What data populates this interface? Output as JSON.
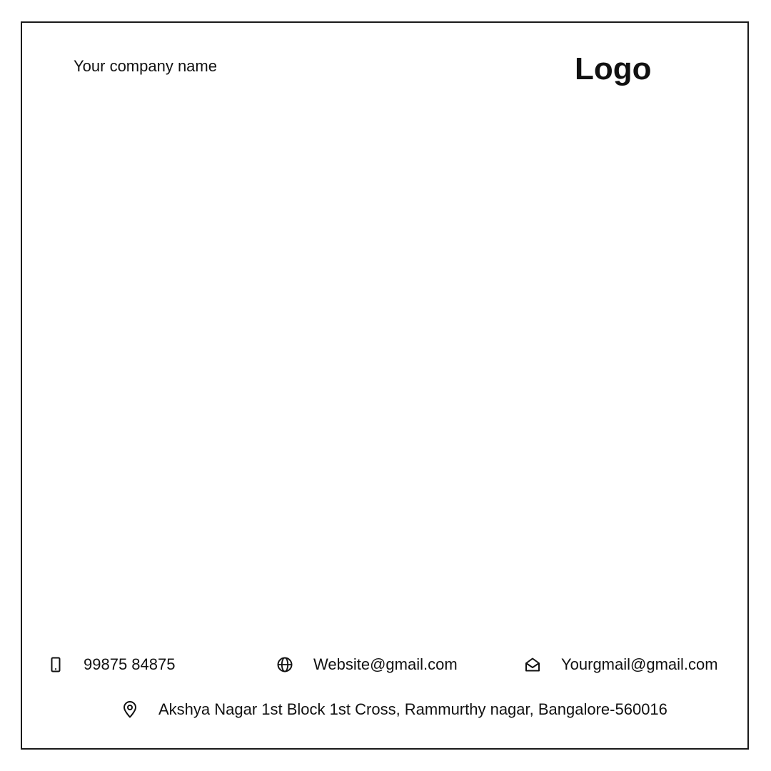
{
  "header": {
    "company_name": "Your company name",
    "logo_text": "Logo"
  },
  "footer": {
    "phone": {
      "icon": "phone-icon",
      "text": "99875 84875"
    },
    "website": {
      "icon": "globe-icon",
      "text": "Website@gmail.com"
    },
    "email": {
      "icon": "mail-open-icon",
      "text": "Yourgmail@gmail.com"
    },
    "address": {
      "icon": "location-pin-icon",
      "text": "Akshya Nagar 1st Block 1st Cross, Rammurthy nagar, Bangalore-560016"
    }
  },
  "colors": {
    "ink": "#111111",
    "background": "#ffffff"
  }
}
